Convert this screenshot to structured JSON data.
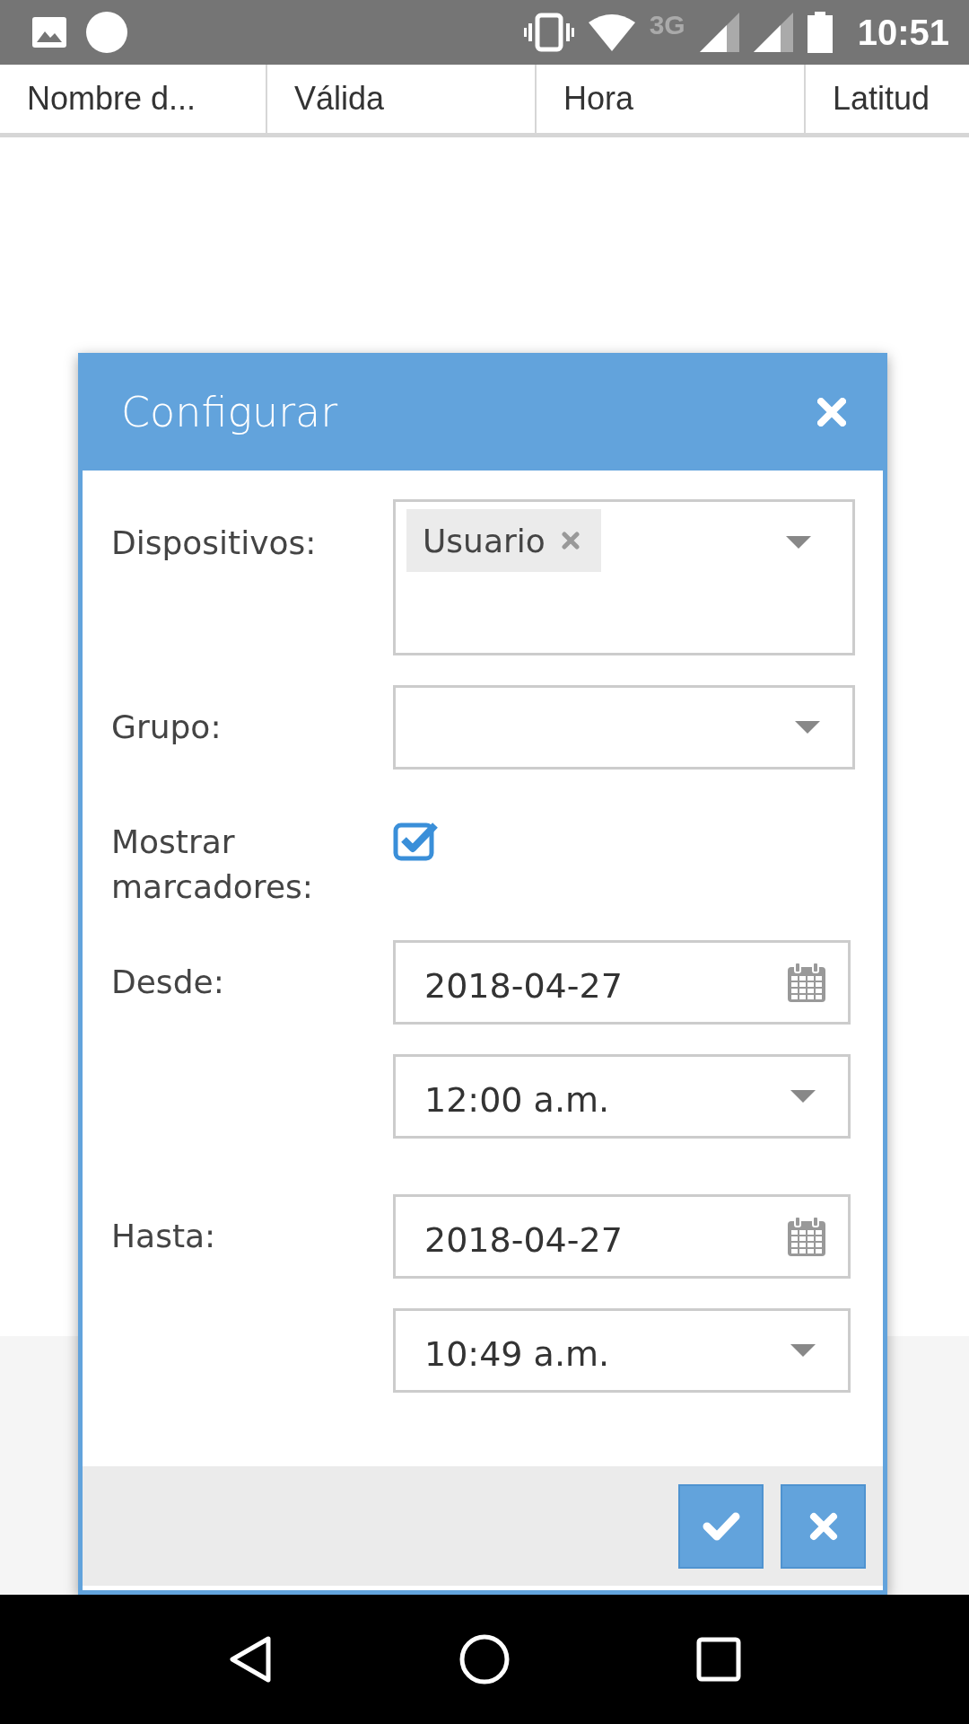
{
  "status_bar": {
    "network": "3G",
    "time": "10:51"
  },
  "table": {
    "columns": [
      "Nombre d...",
      "Válida",
      "Hora",
      "Latitud"
    ]
  },
  "dialog": {
    "title": "Configurar",
    "fields": [
      {
        "kind": "multiselect",
        "label": "Dispositivos:",
        "tags": [
          {
            "label": "Usuario"
          }
        ]
      },
      {
        "kind": "select",
        "label": "Grupo:"
      },
      {
        "kind": "checkbox",
        "label": "Mostrar marcadores:",
        "checked": true
      },
      {
        "kind": "date",
        "label": "Desde:",
        "value": "2018-04-27"
      },
      {
        "kind": "time",
        "value": "12:00 a.m."
      },
      {
        "kind": "date",
        "label": "Hasta:",
        "value": "2018-04-27"
      },
      {
        "kind": "time",
        "value": "10:49 a.m."
      }
    ],
    "buttons": [
      {
        "kind": "confirm"
      },
      {
        "kind": "cancel"
      }
    ]
  }
}
